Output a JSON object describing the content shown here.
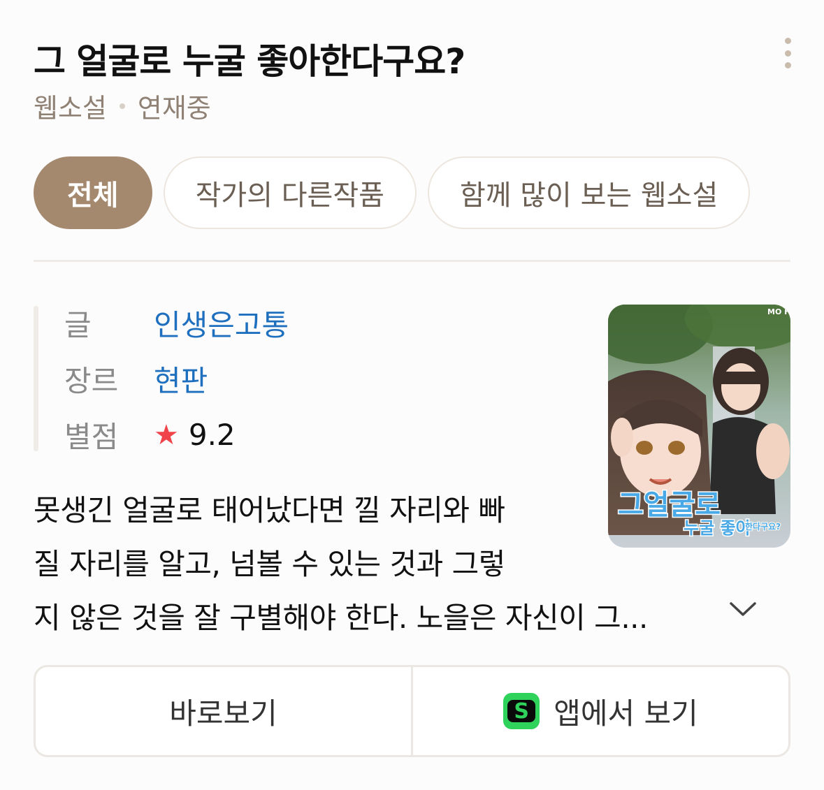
{
  "header": {
    "title": "그 얼굴로 누굴 좋아한다구요?",
    "category": "웹소설",
    "status": "연재중"
  },
  "tabs": [
    {
      "label": "전체",
      "active": true
    },
    {
      "label": "작가의 다른작품",
      "active": false
    },
    {
      "label": "함께 많이 보는 웹소설",
      "active": false
    }
  ],
  "info": {
    "author_label": "글",
    "author": "인생은고통",
    "genre_label": "장르",
    "genre": "현판",
    "rating_label": "별점",
    "rating": "9.2"
  },
  "cover": {
    "badge": "MO FIC",
    "title_line1": "그얼굴로",
    "title_line2": "누굴 좋아",
    "title_line3": "한다구요?"
  },
  "description": {
    "line1": "못생긴 얼굴로 태어났다면 낄 자리와 빠",
    "line2": "질 자리를 알고, 넘볼 수 있는 것과 그렇",
    "line3": "지 않은 것을 잘 구별해야 한다. 노을은 자신이 그..."
  },
  "buttons": {
    "read": "바로보기",
    "app": "앱에서 보기",
    "app_logo": "S"
  },
  "icons": {
    "more": "more-vertical-icon",
    "expand": "chevron-down-icon",
    "star": "star-icon"
  },
  "colors": {
    "accent": "#a4896f",
    "link": "#1f6fbf",
    "star": "#f0434a",
    "app_green": "#2fd35b"
  }
}
